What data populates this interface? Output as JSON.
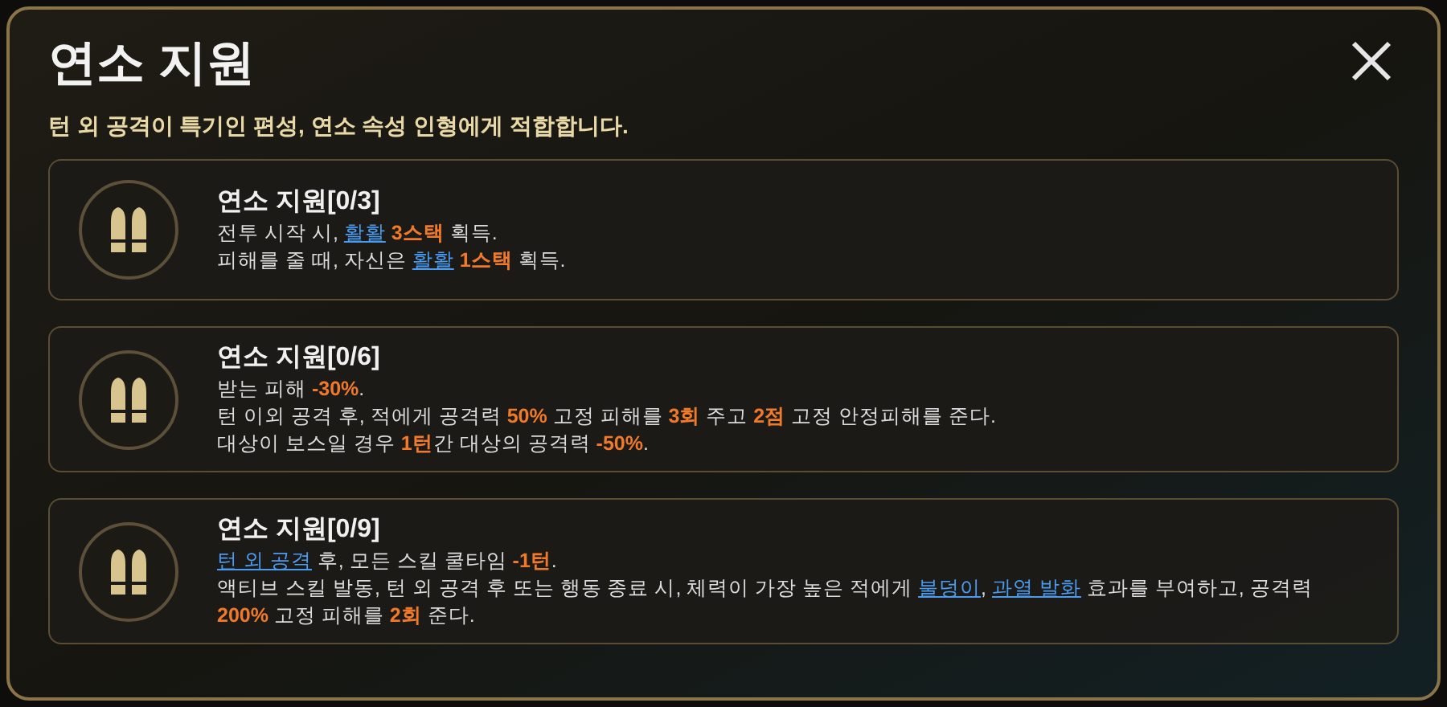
{
  "title": "연소 지원",
  "subtitle": "턴 외 공격이 특기인 편성, 연소 속성 인형에게 적합합니다.",
  "cards": [
    {
      "name": "연소 지원[0/3]",
      "lines": [
        [
          {
            "kind": "text",
            "text": "전투 시작 시, "
          },
          {
            "kind": "link",
            "text": "활활"
          },
          {
            "kind": "value",
            "text": " 3스택"
          },
          {
            "kind": "text",
            "text": " 획득."
          }
        ],
        [
          {
            "kind": "text",
            "text": "피해를 줄 때, 자신은 "
          },
          {
            "kind": "link",
            "text": "활활"
          },
          {
            "kind": "value",
            "text": " 1스택"
          },
          {
            "kind": "text",
            "text": " 획득."
          }
        ]
      ]
    },
    {
      "name": "연소 지원[0/6]",
      "lines": [
        [
          {
            "kind": "text",
            "text": "받는 피해 "
          },
          {
            "kind": "value",
            "text": "-30%"
          },
          {
            "kind": "text",
            "text": "."
          }
        ],
        [
          {
            "kind": "text",
            "text": "턴 이외 공격 후, 적에게 공격력 "
          },
          {
            "kind": "value",
            "text": "50%"
          },
          {
            "kind": "text",
            "text": " 고정 피해를 "
          },
          {
            "kind": "value",
            "text": "3회"
          },
          {
            "kind": "text",
            "text": " 주고 "
          },
          {
            "kind": "value",
            "text": "2점"
          },
          {
            "kind": "text",
            "text": " 고정 안정피해를 준다."
          }
        ],
        [
          {
            "kind": "text",
            "text": "대상이 보스일 경우 "
          },
          {
            "kind": "value",
            "text": "1턴"
          },
          {
            "kind": "text",
            "text": "간 대상의 공격력 "
          },
          {
            "kind": "value",
            "text": "-50%"
          },
          {
            "kind": "text",
            "text": "."
          }
        ]
      ]
    },
    {
      "name": "연소 지원[0/9]",
      "lines": [
        [
          {
            "kind": "link",
            "text": "턴 외 공격"
          },
          {
            "kind": "text",
            "text": " 후, 모든 스킬 쿨타임 "
          },
          {
            "kind": "value",
            "text": "-1턴"
          },
          {
            "kind": "text",
            "text": "."
          }
        ],
        [
          {
            "kind": "text",
            "text": "액티브 스킬 발동, 턴 외 공격 후 또는 행동 종료 시, 체력이 가장 높은 적에게 "
          },
          {
            "kind": "link",
            "text": "불덩이",
            "suffix": ", "
          },
          {
            "kind": "link",
            "text": "과열 발화"
          },
          {
            "kind": "text",
            "text": " 효과를 부여하고, 공격력"
          }
        ],
        [
          {
            "kind": "value",
            "text": "200%"
          },
          {
            "kind": "text",
            "text": " 고정 피해를 "
          },
          {
            "kind": "value",
            "text": "2회"
          },
          {
            "kind": "text",
            "text": " 준다."
          }
        ]
      ]
    }
  ]
}
